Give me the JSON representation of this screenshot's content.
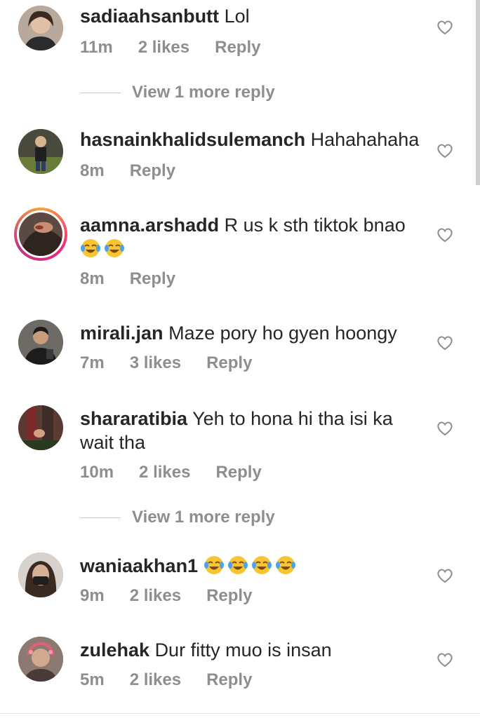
{
  "comments": [
    {
      "username": "sadiaahsanbutt",
      "text": "Lol",
      "time": "11m",
      "likes": "2 likes",
      "reply": "Reply",
      "more_replies": "View 1 more reply",
      "avatar_icon": "profile-photo-woman"
    },
    {
      "username": "hasnainkhalidsulemanch",
      "text": "Hahahahaha",
      "time": "8m",
      "likes": "",
      "reply": "Reply",
      "avatar_icon": "profile-photo-man"
    },
    {
      "username": "aamna.arshadd",
      "text": "R us k sth tiktok bnao",
      "emoji_count": 2,
      "time": "8m",
      "likes": "",
      "reply": "Reply",
      "avatar_icon": "profile-photo-hand"
    },
    {
      "username": "mirali.jan",
      "text": "Maze pory ho gyen hoongy",
      "time": "7m",
      "likes": "3 likes",
      "reply": "Reply",
      "avatar_icon": "profile-photo-man"
    },
    {
      "username": "shararatibia",
      "text": "Yeh to hona hi tha isi ka wait tha",
      "time": "10m",
      "likes": "2 likes",
      "reply": "Reply",
      "more_replies": "View 1 more reply",
      "avatar_icon": "profile-photo-couple"
    },
    {
      "username": "waniaakhan1",
      "text": "",
      "emoji_count": 4,
      "time": "9m",
      "likes": "2 likes",
      "reply": "Reply",
      "avatar_icon": "profile-photo-woman"
    },
    {
      "username": "zulehak",
      "text": "Dur fitty muo is insan",
      "time": "5m",
      "likes": "2 likes",
      "reply": "Reply",
      "avatar_icon": "profile-photo-woman"
    }
  ],
  "colors": {
    "text": "#262626",
    "secondary": "#8e8e8e",
    "story_ring_start": "#f9a23b",
    "story_ring_end": "#c13584"
  },
  "icons": {
    "like": "heart-outline-icon",
    "emoji": "face-with-tears-of-joy-emoji"
  }
}
